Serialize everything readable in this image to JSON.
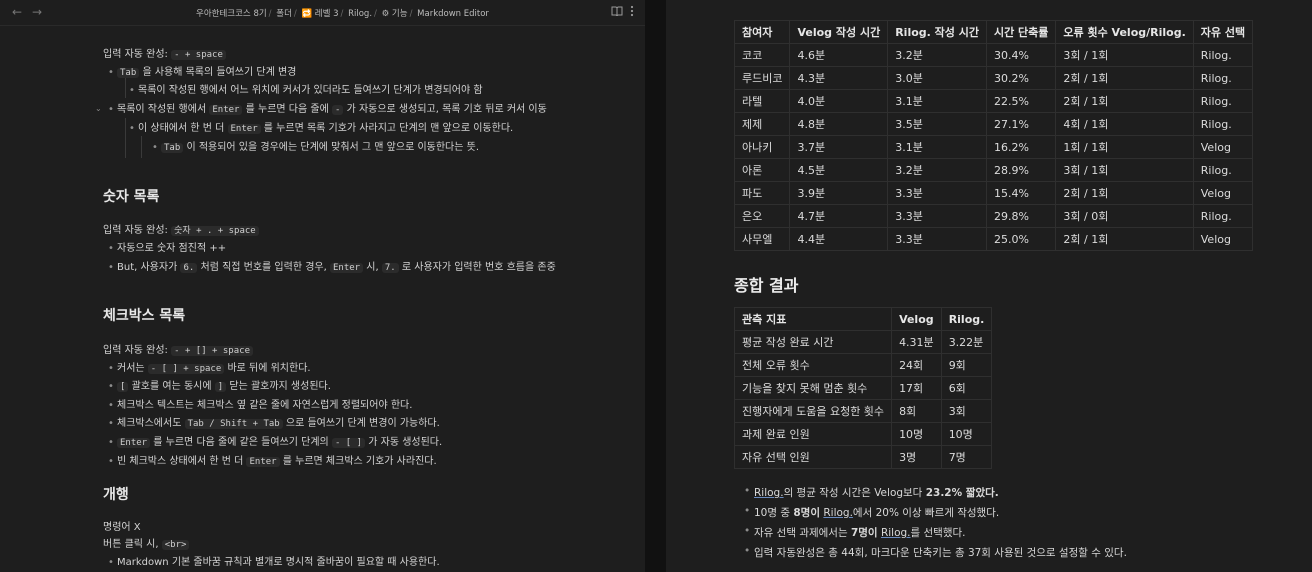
{
  "titlebar": {
    "back": "←",
    "forward": "→",
    "breadcrumbs": [
      "우아한테크코스 8기",
      "폴더",
      "🔁 레벨 3",
      "Rilog.",
      "⚙ 기능",
      "Markdown Editor"
    ],
    "icon_book": "book-open-icon",
    "icon_more": "more-icon"
  },
  "left": {
    "l1": "입력 자동 완성:",
    "l1_code": "- + space",
    "l2": "을 사용해 목록의 들여쓰기 단계 변경",
    "l2_code": "Tab",
    "l3": "목록이 작성된 행에서 어느 위치에 커서가 있더라도 들여쓰기 단계가 변경되어야 함",
    "l4_a": "목록이 작성된 행에서",
    "l4_code": "Enter",
    "l4_b": "를 누르면 다음 줄에",
    "l4_code2": "-",
    "l4_c": "가 자동으로 생성되고, 목록 기호 뒤로 커서 이동",
    "l5_a": "이 상태에서 한 번 더",
    "l5_code": "Enter",
    "l5_b": "를 누르면 목록 기호가 사라지고 단계의 맨 앞으로 이동한다.",
    "l6_code": "Tab",
    "l6_b": "이 적용되어 있을 경우에는 단계에 맞춰서 그 맨 앞으로 이동한다는 뜻.",
    "h_numbered": "숫자 목록",
    "n1": "입력 자동 완성:",
    "n1_code": "숫자 + . + space",
    "n2": "자동으로 숫자 점진적 ++",
    "n3_a": "But, 사용자가",
    "n3_code": "6.",
    "n3_b": "처럼 직접 번호를 입력한 경우,",
    "n3_code2": "Enter",
    "n3_c": "시,",
    "n3_code3": "7.",
    "n3_d": "로 사용자가 입력한 번호 흐름을 존중",
    "h_checkbox": "체크박스 목록",
    "c1": "입력 자동 완성:",
    "c1_code": "- + [] + space",
    "c2_a": "커서는",
    "c2_code": "- [ ] + space",
    "c2_b": "바로 뒤에 위치한다.",
    "c3_code": "[",
    "c3_a": "괄호를 여는 동시에",
    "c3_code2": "]",
    "c3_b": "닫는 괄호까지 생성된다.",
    "c4": "체크박스 텍스트는 체크박스 옆 같은 줄에 자연스럽게 정렬되어야 한다.",
    "c5_a": "체크박스에서도",
    "c5_code": "Tab / Shift + Tab",
    "c5_b": "으로 들여쓰기 단계 변경이 가능하다.",
    "c6_code": "Enter",
    "c6_a": "를 누르면 다음 줄에 같은 들여쓰기 단계의",
    "c6_code2": "- [ ]",
    "c6_b": "가 자동 생성된다.",
    "c7_a": "빈 체크박스 상태에서 한 번 더",
    "c7_code": "Enter",
    "c7_b": "를 누르면 체크박스 기호가 사라진다.",
    "h_linebreak": "개행",
    "b1": "명령어 X",
    "b2": "버튼 클릭 시,",
    "b2_code": "<br>",
    "b3": "Markdown 기본 줄바꿈 규칙과 별개로 명시적 줄바꿈이 필요할 때 사용한다."
  },
  "table1": {
    "headers": [
      "참여자",
      "Velog 작성 시간",
      "Rilog. 작성 시간",
      "시간 단축률",
      "오류 횟수 Velog/Rilog.",
      "자유 선택"
    ],
    "rows": [
      [
        "코코",
        "4.6분",
        "3.2분",
        "30.4%",
        "3회 / 1회",
        "Rilog."
      ],
      [
        "루드비코",
        "4.3분",
        "3.0분",
        "30.2%",
        "2회 / 1회",
        "Rilog."
      ],
      [
        "라텔",
        "4.0분",
        "3.1분",
        "22.5%",
        "2회 / 1회",
        "Rilog."
      ],
      [
        "제제",
        "4.8분",
        "3.5분",
        "27.1%",
        "4회 / 1회",
        "Rilog."
      ],
      [
        "아나키",
        "3.7분",
        "3.1분",
        "16.2%",
        "1회 / 1회",
        "Velog"
      ],
      [
        "아론",
        "4.5분",
        "3.2분",
        "28.9%",
        "3회 / 1회",
        "Rilog."
      ],
      [
        "파도",
        "3.9분",
        "3.3분",
        "15.4%",
        "2회 / 1회",
        "Velog"
      ],
      [
        "은오",
        "4.7분",
        "3.3분",
        "29.8%",
        "3회 / 0회",
        "Rilog."
      ],
      [
        "사무엘",
        "4.4분",
        "3.3분",
        "25.0%",
        "2회 / 1회",
        "Velog"
      ]
    ]
  },
  "summary_heading": "종합 결과",
  "table2": {
    "headers": [
      "관측 지표",
      "Velog",
      "Rilog."
    ],
    "rows": [
      [
        "평균 작성 완료 시간",
        "4.31분",
        "3.22분"
      ],
      [
        "전체 오류 횟수",
        "24회",
        "9회"
      ],
      [
        "기능을 찾지 못해 멈춘 횟수",
        "17회",
        "6회"
      ],
      [
        "진행자에게 도움을 요청한 횟수",
        "8회",
        "3회"
      ],
      [
        "과제 완료 인원",
        "10명",
        "10명"
      ],
      [
        "자유 선택 인원",
        "3명",
        "7명"
      ]
    ]
  },
  "summary_list": {
    "s1_a": "Rilog.",
    "s1_b": "의 평균 작성 시간은 Velog보다",
    "s1_c": "23.2% 짧았다.",
    "s2_a": "10명 중",
    "s2_b": "8명이",
    "s2_c": "Rilog.",
    "s2_d": "에서 20% 이상 빠르게 작성했다.",
    "s3_a": "자유 선택 과제에서는",
    "s3_b": "7명이",
    "s3_c": "Rilog.",
    "s3_d": "를 선택했다.",
    "s4": "입력 자동완성은 총 44회, 마크다운 단축키는 총 37회 사용된 것으로 설정할 수 있다."
  }
}
